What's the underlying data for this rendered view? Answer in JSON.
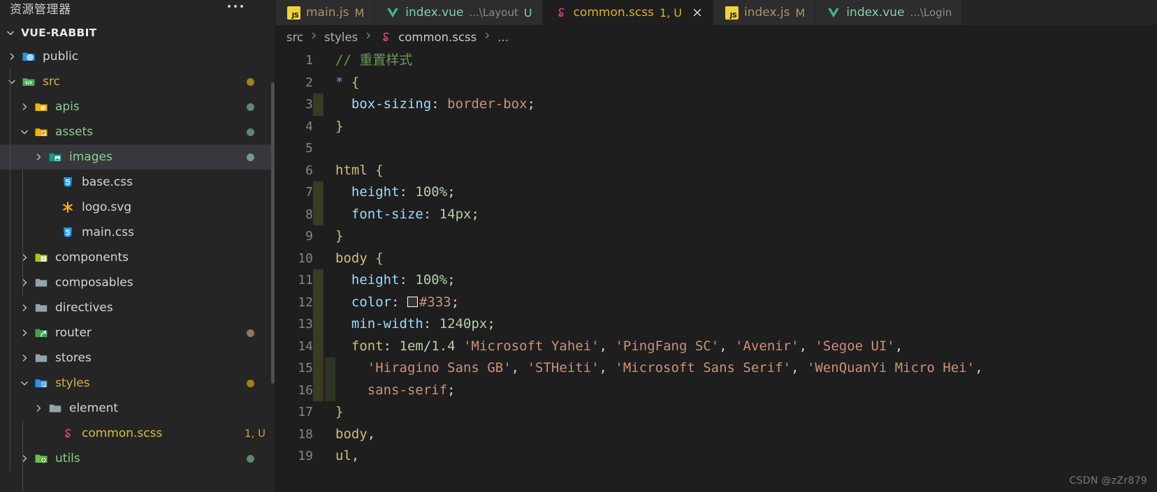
{
  "sidebar": {
    "header_title": "资源管理器",
    "overflow_icon": "ellipsis-icon",
    "root_label": "VUE-RABBIT",
    "scroll_thumb": "sidebar-scrollbar",
    "items": [
      {
        "label": "public",
        "icon": "folder-public-icon",
        "twisty": "chevron-right",
        "indent": 1,
        "color": "c-white",
        "dot": "",
        "badge": "",
        "selected": false
      },
      {
        "label": "src",
        "icon": "folder-src-icon",
        "twisty": "chevron-down",
        "indent": 1,
        "color": "c-yellow",
        "dot": "#9e8118",
        "badge": "",
        "selected": false
      },
      {
        "label": "apis",
        "icon": "folder-api-icon",
        "twisty": "chevron-right",
        "indent": 2,
        "color": "c-green",
        "dot": "#5b8a6d",
        "badge": "",
        "selected": false
      },
      {
        "label": "assets",
        "icon": "folder-assets-icon",
        "twisty": "chevron-down",
        "indent": 2,
        "color": "c-green",
        "dot": "#5b8a6d",
        "badge": "",
        "selected": false
      },
      {
        "label": "images",
        "icon": "folder-images-icon",
        "twisty": "chevron-right",
        "indent": 3,
        "color": "c-green",
        "dot": "#6d9e83",
        "badge": "",
        "selected": true
      },
      {
        "label": "base.css",
        "icon": "css-file-icon",
        "twisty": "",
        "indent": 4,
        "color": "c-white",
        "dot": "",
        "badge": "",
        "selected": false
      },
      {
        "label": "logo.svg",
        "icon": "svg-file-icon",
        "twisty": "",
        "indent": 4,
        "color": "c-white",
        "dot": "",
        "badge": "",
        "selected": false
      },
      {
        "label": "main.css",
        "icon": "css-file-icon",
        "twisty": "",
        "indent": 4,
        "color": "c-white",
        "dot": "",
        "badge": "",
        "selected": false
      },
      {
        "label": "components",
        "icon": "folder-components-icon",
        "twisty": "chevron-right",
        "indent": 2,
        "color": "c-white",
        "dot": "",
        "badge": "",
        "selected": false
      },
      {
        "label": "composables",
        "icon": "folder-icon",
        "twisty": "chevron-right",
        "indent": 2,
        "color": "c-white",
        "dot": "",
        "badge": "",
        "selected": false
      },
      {
        "label": "directives",
        "icon": "folder-icon",
        "twisty": "chevron-right",
        "indent": 2,
        "color": "c-white",
        "dot": "",
        "badge": "",
        "selected": false
      },
      {
        "label": "router",
        "icon": "folder-router-icon",
        "twisty": "chevron-right",
        "indent": 2,
        "color": "c-white",
        "dot": "#8a7a5b",
        "badge": "",
        "selected": false
      },
      {
        "label": "stores",
        "icon": "folder-icon",
        "twisty": "chevron-right",
        "indent": 2,
        "color": "c-white",
        "dot": "",
        "badge": "",
        "selected": false
      },
      {
        "label": "styles",
        "icon": "folder-styles-icon",
        "twisty": "chevron-down",
        "indent": 2,
        "color": "c-yellow",
        "dot": "#9e8118",
        "badge": "",
        "selected": false
      },
      {
        "label": "element",
        "icon": "folder-icon",
        "twisty": "chevron-right",
        "indent": 3,
        "color": "c-white",
        "dot": "",
        "badge": "",
        "selected": false
      },
      {
        "label": "common.scss",
        "icon": "scss-file-icon",
        "twisty": "",
        "indent": 4,
        "color": "c-scss",
        "dot": "",
        "badge": "1, U",
        "selected": false
      },
      {
        "label": "utils",
        "icon": "folder-utils-icon",
        "twisty": "chevron-right",
        "indent": 2,
        "color": "c-green",
        "dot": "#5b8a6d",
        "badge": "",
        "selected": false
      }
    ]
  },
  "tabs": [
    {
      "name": "main.js",
      "path": "",
      "status": "M",
      "icon": "js-file-icon",
      "kind": "t-js dim",
      "active": false,
      "closable": false
    },
    {
      "name": "index.vue",
      "path": "...\\Layout",
      "status": "U",
      "icon": "vue-file-icon",
      "kind": "t-vue",
      "active": false,
      "closable": false
    },
    {
      "name": "common.scss",
      "path": "",
      "status": "1, U",
      "icon": "scss-file-icon",
      "kind": "t-scss",
      "active": true,
      "closable": true,
      "close_icon": "close-icon"
    },
    {
      "name": "index.js",
      "path": "",
      "status": "M",
      "icon": "js-file-icon",
      "kind": "t-js dim",
      "active": false,
      "closable": false
    },
    {
      "name": "index.vue",
      "path": "...\\Login",
      "status": "",
      "icon": "vue-file-icon",
      "kind": "t-vue",
      "active": false,
      "closable": false
    }
  ],
  "breadcrumb": {
    "parts": [
      "src",
      "styles",
      "common.scss",
      "..."
    ],
    "file_icon": "scss-file-icon",
    "separator": "chevron-right-icon"
  },
  "code": {
    "first_line": 1,
    "lines": [
      {
        "n": "1",
        "guides": [],
        "tokens": [
          {
            "t": "// 重置样式",
            "c": "t-comment"
          }
        ]
      },
      {
        "n": "2",
        "guides": [],
        "tokens": [
          {
            "t": "*",
            "c": "t-star"
          },
          {
            "t": " ",
            "c": "t-punc"
          },
          {
            "t": "{",
            "c": "t-brace"
          }
        ]
      },
      {
        "n": "3",
        "guides": [
          "a"
        ],
        "tokens": [
          {
            "t": "  ",
            "c": "t-punc"
          },
          {
            "t": "box-sizing",
            "c": "t-prop"
          },
          {
            "t": ": ",
            "c": "t-punc"
          },
          {
            "t": "border-box",
            "c": "t-val"
          },
          {
            "t": ";",
            "c": "t-punc"
          }
        ]
      },
      {
        "n": "4",
        "guides": [],
        "tokens": [
          {
            "t": "}",
            "c": "t-brace"
          }
        ]
      },
      {
        "n": "5",
        "guides": [],
        "tokens": []
      },
      {
        "n": "6",
        "guides": [],
        "tokens": [
          {
            "t": "html",
            "c": "t-sel"
          },
          {
            "t": " ",
            "c": "t-punc"
          },
          {
            "t": "{",
            "c": "t-brace"
          }
        ]
      },
      {
        "n": "7",
        "guides": [
          "a"
        ],
        "tokens": [
          {
            "t": "  ",
            "c": "t-punc"
          },
          {
            "t": "height",
            "c": "t-prop"
          },
          {
            "t": ": ",
            "c": "t-punc"
          },
          {
            "t": "100%",
            "c": "t-num"
          },
          {
            "t": ";",
            "c": "t-punc"
          }
        ]
      },
      {
        "n": "8",
        "guides": [
          "a"
        ],
        "tokens": [
          {
            "t": "  ",
            "c": "t-punc"
          },
          {
            "t": "font-size",
            "c": "t-prop"
          },
          {
            "t": ": ",
            "c": "t-punc"
          },
          {
            "t": "14px",
            "c": "t-num"
          },
          {
            "t": ";",
            "c": "t-punc"
          }
        ]
      },
      {
        "n": "9",
        "guides": [],
        "tokens": [
          {
            "t": "}",
            "c": "t-brace"
          }
        ]
      },
      {
        "n": "10",
        "guides": [],
        "tokens": [
          {
            "t": "body",
            "c": "t-sel"
          },
          {
            "t": " ",
            "c": "t-punc"
          },
          {
            "t": "{",
            "c": "t-brace"
          }
        ]
      },
      {
        "n": "11",
        "guides": [
          "a"
        ],
        "tokens": [
          {
            "t": "  ",
            "c": "t-punc"
          },
          {
            "t": "height",
            "c": "t-prop"
          },
          {
            "t": ": ",
            "c": "t-punc"
          },
          {
            "t": "100%",
            "c": "t-num"
          },
          {
            "t": ";",
            "c": "t-punc"
          }
        ]
      },
      {
        "n": "12",
        "guides": [
          "a"
        ],
        "tokens": [
          {
            "t": "  ",
            "c": "t-punc"
          },
          {
            "t": "color",
            "c": "t-prop"
          },
          {
            "t": ": ",
            "c": "t-punc"
          },
          {
            "t": "__SWATCH__",
            "c": "swatch-slot"
          },
          {
            "t": "#333",
            "c": "t-val"
          },
          {
            "t": ";",
            "c": "t-punc"
          }
        ]
      },
      {
        "n": "13",
        "guides": [
          "a"
        ],
        "tokens": [
          {
            "t": "  ",
            "c": "t-punc"
          },
          {
            "t": "min-width",
            "c": "t-prop"
          },
          {
            "t": ": ",
            "c": "t-punc"
          },
          {
            "t": "1240px",
            "c": "t-num"
          },
          {
            "t": ";",
            "c": "t-punc"
          }
        ]
      },
      {
        "n": "14",
        "guides": [
          "a"
        ],
        "tokens": [
          {
            "t": "  ",
            "c": "t-punc"
          },
          {
            "t": "font",
            "c": "t-sel"
          },
          {
            "t": ": ",
            "c": "t-punc"
          },
          {
            "t": "1em",
            "c": "t-num"
          },
          {
            "t": "/",
            "c": "t-punc"
          },
          {
            "t": "1.4",
            "c": "t-num"
          },
          {
            "t": " ",
            "c": "t-punc"
          },
          {
            "t": "'Microsoft Yahei'",
            "c": "t-val"
          },
          {
            "t": ", ",
            "c": "t-punc"
          },
          {
            "t": "'PingFang SC'",
            "c": "t-val"
          },
          {
            "t": ", ",
            "c": "t-punc"
          },
          {
            "t": "'Avenir'",
            "c": "t-val"
          },
          {
            "t": ", ",
            "c": "t-punc"
          },
          {
            "t": "'Segoe UI'",
            "c": "t-val"
          },
          {
            "t": ",",
            "c": "t-punc"
          }
        ]
      },
      {
        "n": "15",
        "guides": [
          "a",
          "b"
        ],
        "tokens": [
          {
            "t": "    ",
            "c": "t-punc"
          },
          {
            "t": "'Hiragino Sans GB'",
            "c": "t-val"
          },
          {
            "t": ", ",
            "c": "t-punc"
          },
          {
            "t": "'STHeiti'",
            "c": "t-val"
          },
          {
            "t": ", ",
            "c": "t-punc"
          },
          {
            "t": "'Microsoft Sans Serif'",
            "c": "t-val"
          },
          {
            "t": ", ",
            "c": "t-punc"
          },
          {
            "t": "'WenQuanYi Micro Hei'",
            "c": "t-val"
          },
          {
            "t": ",",
            "c": "t-punc"
          }
        ]
      },
      {
        "n": "16",
        "guides": [
          "a",
          "b"
        ],
        "tokens": [
          {
            "t": "    ",
            "c": "t-punc"
          },
          {
            "t": "sans-serif",
            "c": "t-val"
          },
          {
            "t": ";",
            "c": "t-punc"
          }
        ]
      },
      {
        "n": "17",
        "guides": [],
        "tokens": [
          {
            "t": "}",
            "c": "t-brace"
          }
        ]
      },
      {
        "n": "18",
        "guides": [],
        "tokens": [
          {
            "t": "body",
            "c": "t-sel"
          },
          {
            "t": ",",
            "c": "t-punc"
          }
        ]
      },
      {
        "n": "19",
        "guides": [],
        "tokens": [
          {
            "t": "ul",
            "c": "t-sel"
          },
          {
            "t": ",",
            "c": "t-punc"
          }
        ]
      }
    ]
  },
  "watermark": "CSDN @zZr879",
  "colors": {
    "sidebar_bg": "#252526",
    "editor_bg": "#1e1e1e",
    "selection_bg": "#37373d",
    "tab_inactive_bg": "#2d2d2d",
    "comment": "#6a9955",
    "string": "#ce9178",
    "property": "#9cdcfe",
    "number": "#b5cea8",
    "selector": "#d7ba7d"
  }
}
